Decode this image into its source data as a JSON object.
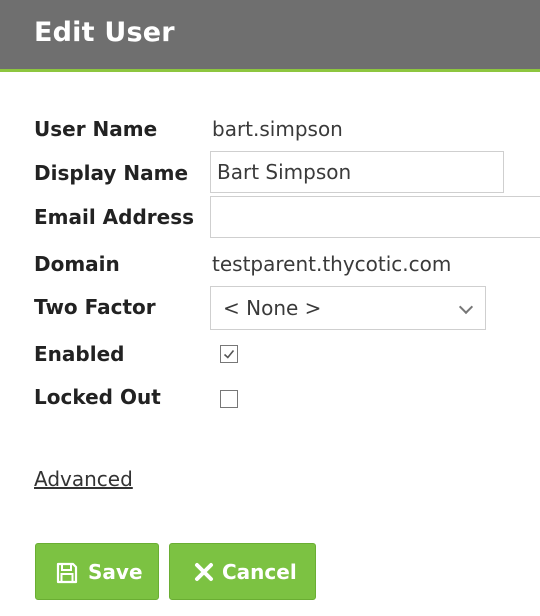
{
  "header": {
    "title": "Edit User"
  },
  "form": {
    "user_name": {
      "label": "User Name",
      "value": "bart.simpson"
    },
    "display_name": {
      "label": "Display Name",
      "value": "Bart Simpson"
    },
    "email": {
      "label": "Email Address",
      "value": ""
    },
    "domain": {
      "label": "Domain",
      "value": "testparent.thycotic.com"
    },
    "two_factor": {
      "label": "Two Factor",
      "selected": "< None >"
    },
    "enabled": {
      "label": "Enabled",
      "checked": true
    },
    "locked_out": {
      "label": "Locked Out",
      "checked": false
    }
  },
  "advanced_link": "Advanced",
  "buttons": {
    "save": "Save",
    "cancel": "Cancel"
  },
  "icons": {
    "save": "floppy-disk-icon",
    "cancel": "x-icon",
    "dropdown": "chevron-down-icon",
    "check": "check-icon"
  },
  "colors": {
    "header_bg": "#6f6f6f",
    "header_accent": "#8dc63f",
    "button_bg": "#7cc242"
  }
}
